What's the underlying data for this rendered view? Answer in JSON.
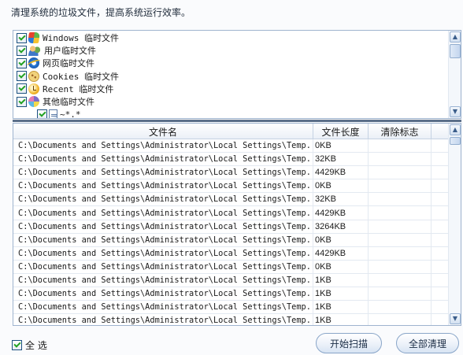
{
  "header": {
    "description": "清理系统的垃圾文件，提高系统运行效率。"
  },
  "tree": {
    "items": [
      {
        "label": "Windows 临时文件",
        "icon": "windows-icon",
        "checked": true
      },
      {
        "label": "用户临时文件",
        "icon": "users-icon",
        "checked": true
      },
      {
        "label": "网页临时文件",
        "icon": "internet-explorer-icon",
        "checked": true
      },
      {
        "label": "Cookies 临时文件",
        "icon": "cookie-icon",
        "checked": true
      },
      {
        "label": "Recent 临时文件",
        "icon": "recent-clock-icon",
        "checked": true
      },
      {
        "label": "其他临时文件",
        "icon": "other-files-icon",
        "checked": true
      }
    ],
    "child": {
      "label": "~*.*",
      "icon": "file-icon",
      "checked": true
    }
  },
  "table": {
    "columns": [
      "文件名",
      "文件长度",
      "清除标志"
    ],
    "rows": [
      {
        "name": "C:\\Documents and Settings\\Administrator\\Local Settings\\Temp...",
        "size": "0KB",
        "flag": ""
      },
      {
        "name": "C:\\Documents and Settings\\Administrator\\Local Settings\\Temp...",
        "size": "32KB",
        "flag": ""
      },
      {
        "name": "C:\\Documents and Settings\\Administrator\\Local Settings\\Temp...",
        "size": "4429KB",
        "flag": ""
      },
      {
        "name": "C:\\Documents and Settings\\Administrator\\Local Settings\\Temp...",
        "size": "0KB",
        "flag": ""
      },
      {
        "name": "C:\\Documents and Settings\\Administrator\\Local Settings\\Temp...",
        "size": "32KB",
        "flag": ""
      },
      {
        "name": "C:\\Documents and Settings\\Administrator\\Local Settings\\Temp...",
        "size": "4429KB",
        "flag": ""
      },
      {
        "name": "C:\\Documents and Settings\\Administrator\\Local Settings\\Temp...",
        "size": "3264KB",
        "flag": ""
      },
      {
        "name": "C:\\Documents and Settings\\Administrator\\Local Settings\\Temp...",
        "size": "0KB",
        "flag": ""
      },
      {
        "name": "C:\\Documents and Settings\\Administrator\\Local Settings\\Temp...",
        "size": "4429KB",
        "flag": ""
      },
      {
        "name": "C:\\Documents and Settings\\Administrator\\Local Settings\\Temp...",
        "size": "0KB",
        "flag": ""
      },
      {
        "name": "C:\\Documents and Settings\\Administrator\\Local Settings\\Temp...",
        "size": "1KB",
        "flag": ""
      },
      {
        "name": "C:\\Documents and Settings\\Administrator\\Local Settings\\Temp...",
        "size": "1KB",
        "flag": ""
      },
      {
        "name": "C:\\Documents and Settings\\Administrator\\Local Settings\\Temp...",
        "size": "1KB",
        "flag": ""
      },
      {
        "name": "C:\\Documents and Settings\\Administrator\\Local Settings\\Temp...",
        "size": "1KB",
        "flag": ""
      }
    ]
  },
  "footer": {
    "select_all_label": "全 选",
    "select_all_checked": true,
    "scan_button": "开始扫描",
    "clean_button": "全部清理"
  },
  "colors": {
    "accent_border": "#9fb4cf",
    "checkmark": "#21a121",
    "splitter": "#5b6f8a"
  }
}
